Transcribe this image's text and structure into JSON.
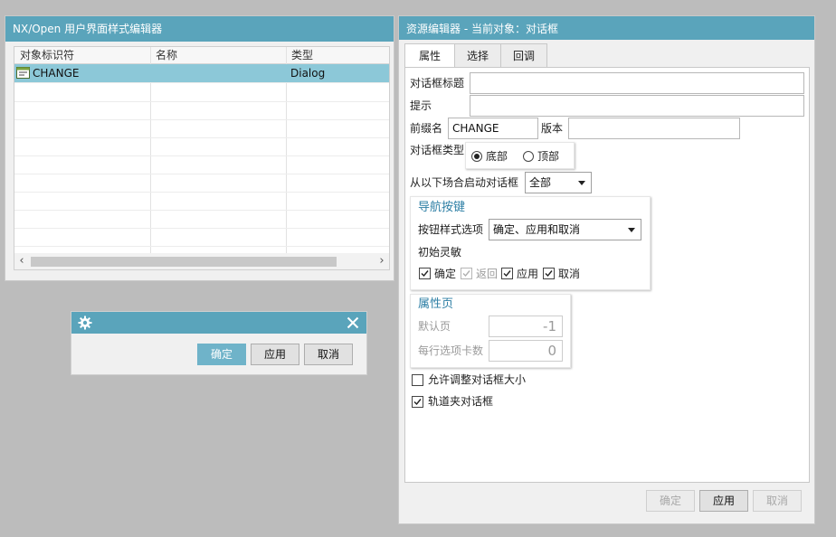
{
  "left_panel": {
    "title": "NX/Open 用户界面样式编辑器",
    "columns": [
      "对象标识符",
      "名称",
      "类型"
    ],
    "rows": [
      {
        "identifier": "CHANGE",
        "name": "",
        "type": "Dialog",
        "icon": "dialog-icon"
      }
    ]
  },
  "small_dialog": {
    "icon": "gear-icon",
    "buttons": {
      "ok": "确定",
      "apply": "应用",
      "cancel": "取消"
    }
  },
  "right_panel": {
    "title": "资源编辑器 - 当前对象：对话框",
    "tabs": [
      "属性",
      "选择",
      "回调"
    ],
    "active_tab": "属性",
    "fields": {
      "dialog_title_label": "对话框标题",
      "dialog_title_value": "",
      "hint_label": "提示",
      "hint_value": "",
      "prefix_label": "前缀名",
      "prefix_value": "CHANGE",
      "version_label": "版本",
      "version_value": "",
      "dialog_type_label": "对话框类型",
      "dialog_type_options": [
        "底部",
        "顶部"
      ],
      "dialog_type_selected": "底部",
      "launch_label": "从以下场合启动对话框",
      "launch_value": "全部"
    },
    "nav_group": {
      "title": "导航按键",
      "button_style_label": "按钮样式选项",
      "button_style_value": "确定、应用和取消",
      "sensitivity_label": "初始灵敏",
      "checks": [
        {
          "label": "确定",
          "checked": true,
          "enabled": true
        },
        {
          "label": "返回",
          "checked": true,
          "enabled": false
        },
        {
          "label": "应用",
          "checked": true,
          "enabled": true
        },
        {
          "label": "取消",
          "checked": true,
          "enabled": true
        }
      ]
    },
    "property_page": {
      "title": "属性页",
      "default_page_label": "默认页",
      "default_page_value": "-1",
      "tabs_per_row_label": "每行选项卡数",
      "tabs_per_row_value": "0"
    },
    "options": [
      {
        "label": "允许调整对话框大小",
        "checked": false
      },
      {
        "label": "轨道夹对话框",
        "checked": true
      }
    ],
    "footer_buttons": {
      "ok": "确定",
      "apply": "应用",
      "cancel": "取消"
    }
  },
  "colors": {
    "accent": "#5aa4bb",
    "selection": "#8cc8d8",
    "group_title": "#2e7fa5"
  }
}
